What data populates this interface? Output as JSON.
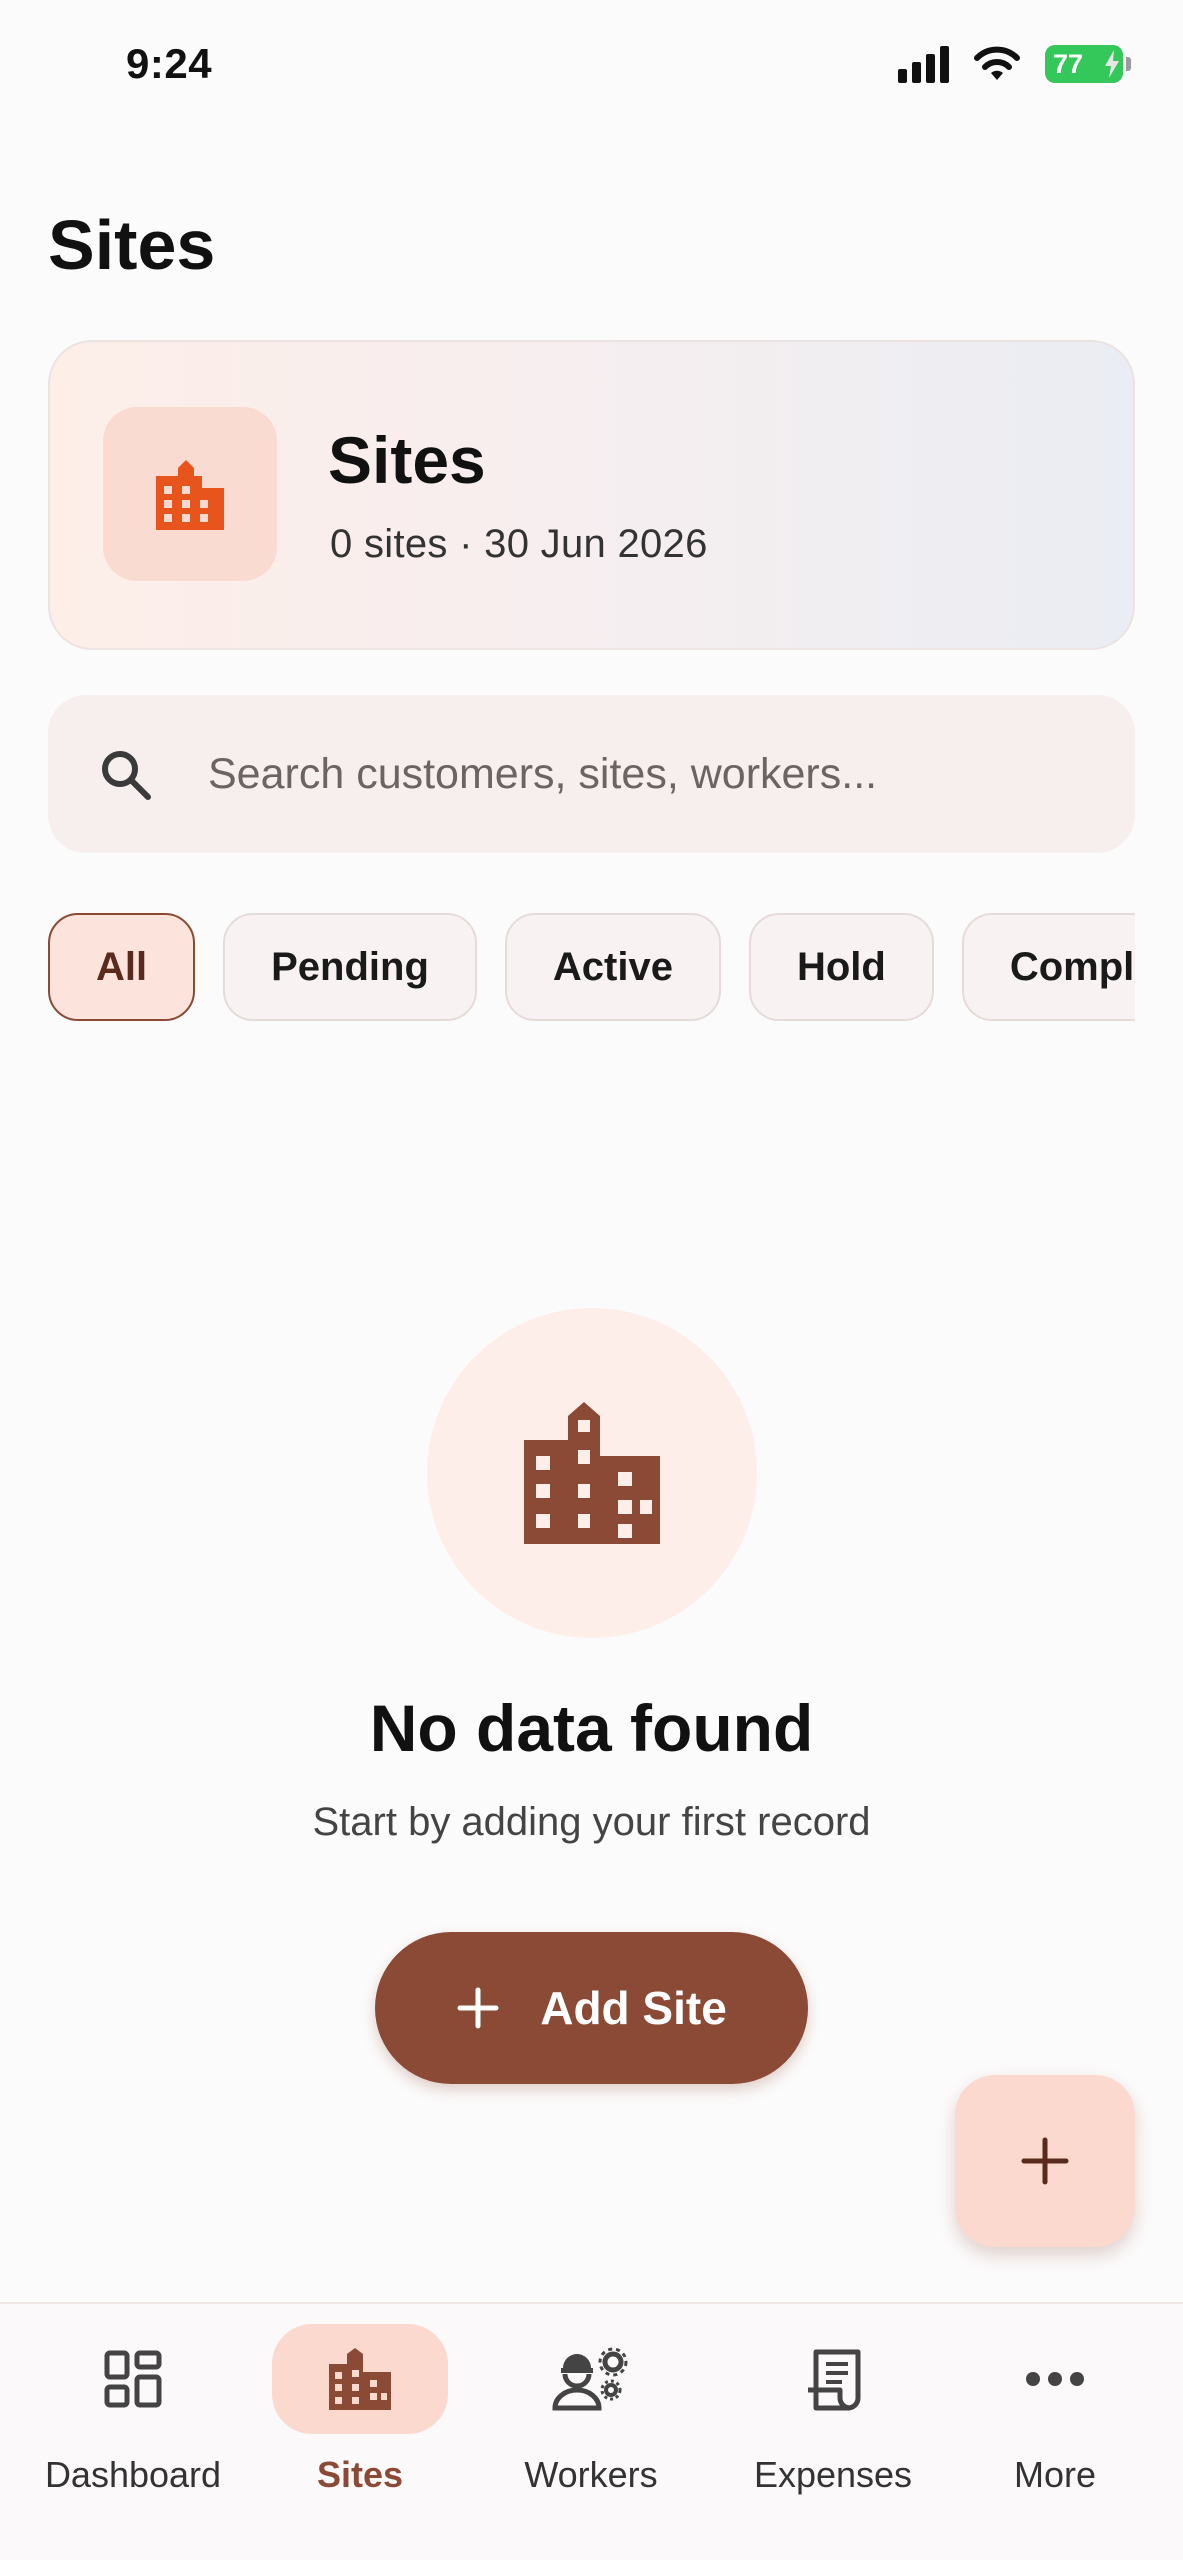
{
  "status_bar": {
    "time": "9:24",
    "battery": "77"
  },
  "page": {
    "title": "Sites"
  },
  "summary_card": {
    "title": "Sites",
    "subtitle": "0 sites · 30 Jun 2026",
    "icon": "building-icon"
  },
  "search": {
    "value": "",
    "placeholder": "Search customers, sites, workers..."
  },
  "filters": {
    "chips": [
      {
        "label": "All",
        "active": true
      },
      {
        "label": "Pending",
        "active": false
      },
      {
        "label": "Active",
        "active": false
      },
      {
        "label": "Hold",
        "active": false
      },
      {
        "label": "Completed",
        "active": false
      }
    ]
  },
  "empty_state": {
    "icon": "building-icon",
    "title": "No data found",
    "subtitle": "Start by adding your first record",
    "button_label": "Add Site"
  },
  "fab": {
    "icon": "plus-icon"
  },
  "bottom_nav": {
    "items": [
      {
        "label": "Dashboard",
        "icon": "grid-icon",
        "active": false
      },
      {
        "label": "Sites",
        "icon": "building-icon",
        "active": true
      },
      {
        "label": "Workers",
        "icon": "worker-gear-icon",
        "active": false
      },
      {
        "label": "Expenses",
        "icon": "receipt-icon",
        "active": false
      },
      {
        "label": "More",
        "icon": "more-dots-icon",
        "active": false
      }
    ]
  },
  "colors": {
    "accent": "#8b4a35",
    "accent_soft": "#fbd9cf",
    "icon_orange": "#e8551c",
    "battery_green": "#34c759"
  }
}
